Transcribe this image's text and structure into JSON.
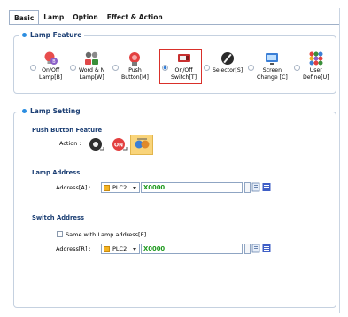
{
  "tabs": [
    {
      "label": "Basic",
      "active": true
    },
    {
      "label": "Lamp"
    },
    {
      "label": "Option"
    },
    {
      "label": "Effect & Action"
    }
  ],
  "lamp_feature": {
    "title": "Lamp Feature",
    "items": [
      {
        "label": "On/Off\nLamp[B]",
        "icon": "lamp-bulb-icon",
        "selected": false
      },
      {
        "label": "Word & N\nLamp[W]",
        "icon": "word-lamp-icon",
        "selected": false
      },
      {
        "label": "Push\nButton[M]",
        "icon": "push-button-icon",
        "selected": false
      },
      {
        "label": "On/Off\nSwitch[T]",
        "icon": "switch-icon",
        "selected": true
      },
      {
        "label": "Selector[S]",
        "icon": "selector-icon",
        "selected": false
      },
      {
        "label": "Screen\nChange [C]",
        "icon": "screen-change-icon",
        "selected": false
      },
      {
        "label": "User\nDefine[U]",
        "icon": "user-define-icon",
        "selected": false
      }
    ]
  },
  "lamp_setting": {
    "title": "Lamp Setting",
    "push_button_feature": {
      "title": "Push Button Feature",
      "action_label": "Action :",
      "actions": [
        "momentary-icon",
        "on-icon",
        "toggle-icon"
      ],
      "selected_action": 2
    },
    "lamp_address": {
      "title": "Lamp Address",
      "address_label": "Address[A] :",
      "plc": "PLC2",
      "value": "X0000"
    },
    "switch_address": {
      "title": "Switch Address",
      "same_label": "Same with Lamp address[E]",
      "same_checked": false,
      "address_label": "Address[R] :",
      "plc": "PLC2",
      "value": "X0000"
    }
  },
  "colors": {
    "accent": "#2b8de0",
    "selection": "#d9302a",
    "address_text": "#1e9a1e"
  }
}
